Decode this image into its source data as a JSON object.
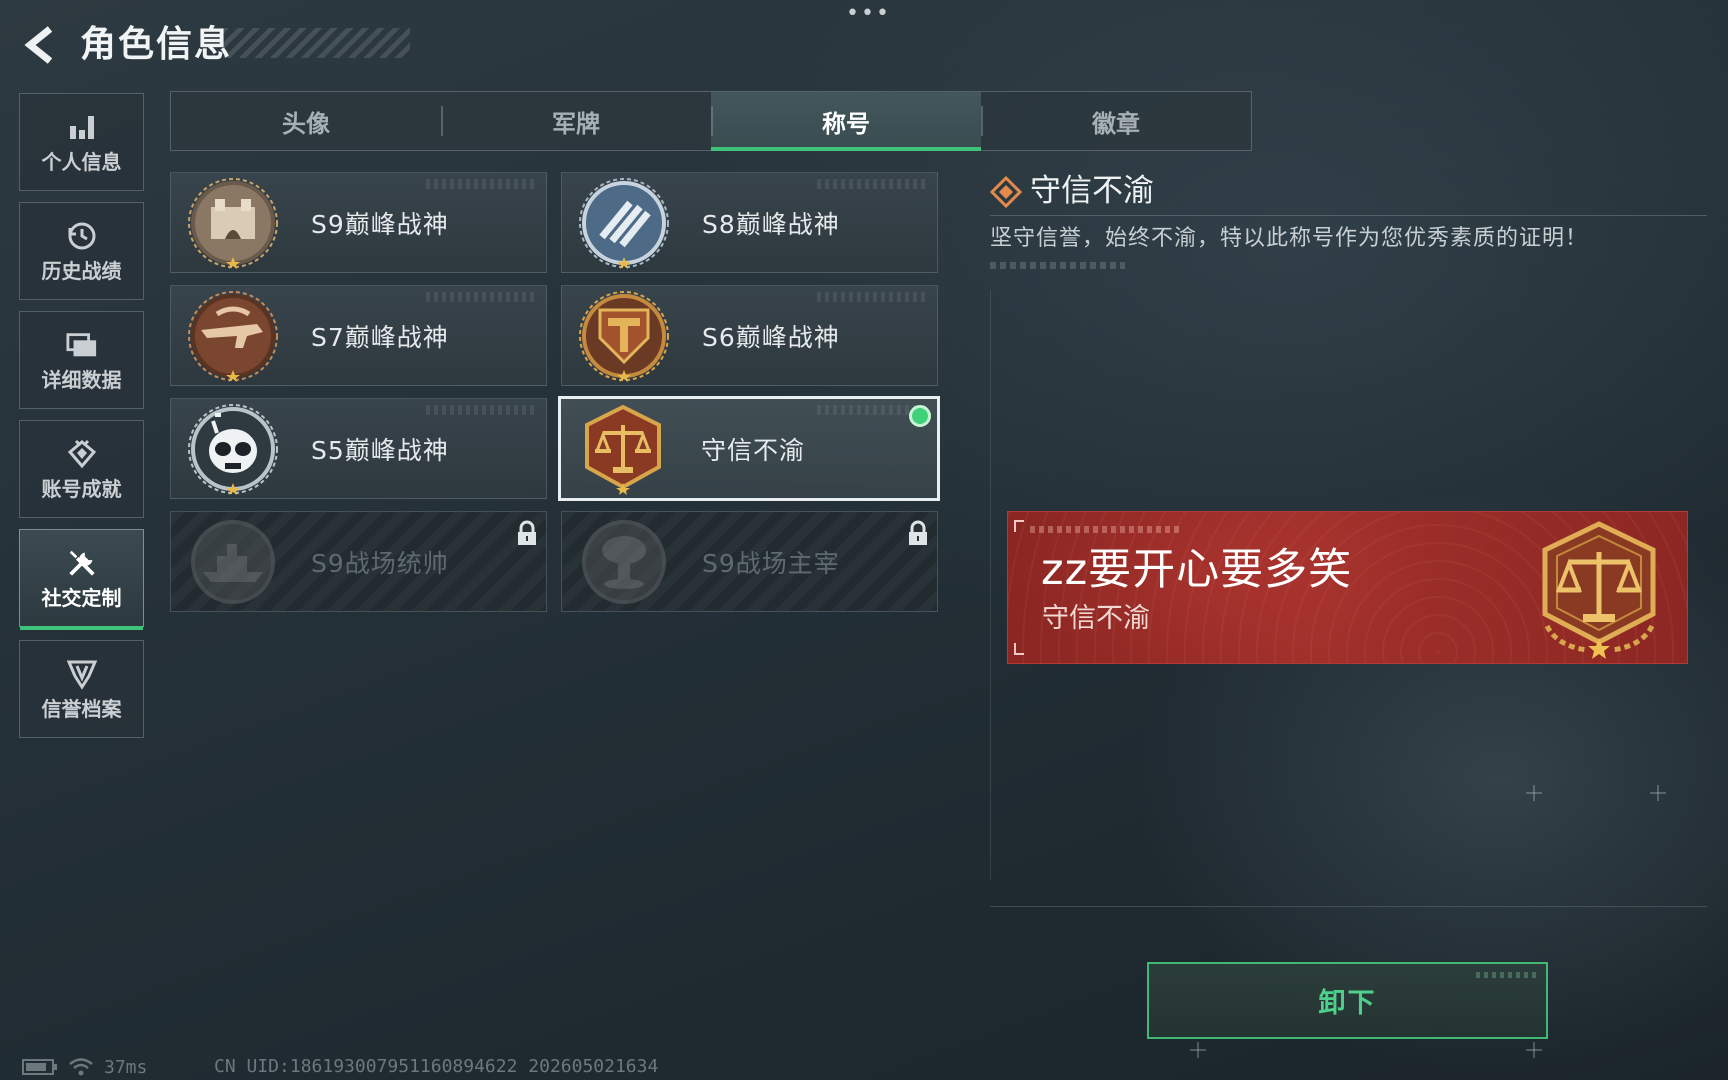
{
  "header": {
    "title": "角色信息",
    "more": "•••"
  },
  "sidebar": {
    "items": [
      {
        "label": "个人信息",
        "icon": "bar-chart-icon",
        "active": false
      },
      {
        "label": "历史战绩",
        "icon": "history-clock-icon",
        "active": false
      },
      {
        "label": "详细数据",
        "icon": "folder-icon",
        "active": false
      },
      {
        "label": "账号成就",
        "icon": "achievement-icon",
        "active": false
      },
      {
        "label": "社交定制",
        "icon": "wrench-screwdriver-icon",
        "active": true
      },
      {
        "label": "信誉档案",
        "icon": "reputation-shield-icon",
        "active": false
      }
    ]
  },
  "tabs": [
    {
      "label": "头像",
      "active": false
    },
    {
      "label": "军牌",
      "active": false
    },
    {
      "label": "称号",
      "active": true
    },
    {
      "label": "徽章",
      "active": false
    }
  ],
  "titles": [
    {
      "name": "S9巅峰战神",
      "emblem": "fortress-emblem-icon",
      "state": "normal"
    },
    {
      "name": "S8巅峰战神",
      "emblem": "blue-stripes-emblem-icon",
      "state": "normal"
    },
    {
      "name": "S7巅峰战神",
      "emblem": "weapon-emblem-icon",
      "state": "normal"
    },
    {
      "name": "S6巅峰战神",
      "emblem": "t-shield-emblem-icon",
      "state": "normal"
    },
    {
      "name": "S5巅峰战神",
      "emblem": "skull-mask-emblem-icon",
      "state": "normal"
    },
    {
      "name": "守信不渝",
      "emblem": "scales-emblem-icon",
      "state": "selected"
    },
    {
      "name": "S9战场统帅",
      "emblem": "warship-emblem-icon",
      "state": "locked"
    },
    {
      "name": "S9战场主宰",
      "emblem": "mushroom-cloud-emblem-icon",
      "state": "locked"
    }
  ],
  "detail": {
    "title": "守信不渝",
    "description": "坚守信誉，始终不渝，特以此称号作为您优秀素质的证明！",
    "icon": "diamond-cluster-icon"
  },
  "nameplate": {
    "player_name": "zz要开心要多笑",
    "title": "守信不渝",
    "emblem": "scales-emblem-icon"
  },
  "actions": {
    "unequip_label": "卸下"
  },
  "status": {
    "ping": "37ms",
    "uid": "CN UID:1861930079511608946​22 202605021634"
  },
  "colors": {
    "accent_green": "#3fc27a",
    "banner_red": "#a1302b",
    "emblem_bronze": "#b5703a",
    "emblem_gold": "#d9a54a"
  }
}
